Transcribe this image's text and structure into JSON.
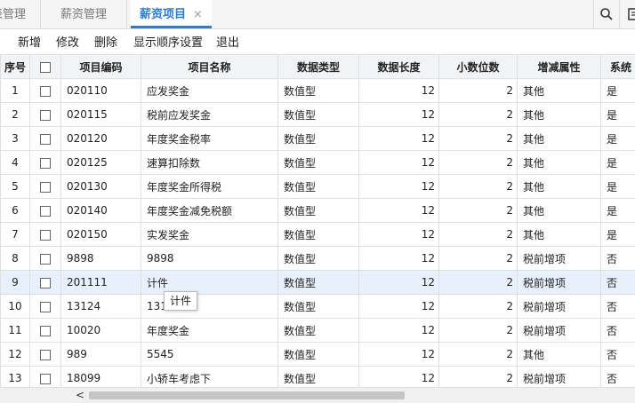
{
  "tabs": [
    {
      "label": "表管理",
      "active": false
    },
    {
      "label": "薪资管理",
      "active": false
    },
    {
      "label": "薪资项目",
      "active": true
    }
  ],
  "tab_close_glyph": "×",
  "icons": {
    "search": "search-icon",
    "more": "more-icon"
  },
  "toolbar": {
    "add_label": "新增",
    "edit_label": "修改",
    "delete_label": "删除",
    "order_label": "显示顺序设置",
    "exit_label": "退出"
  },
  "table": {
    "headers": {
      "seq": "序号",
      "code": "项目编码",
      "name": "项目名称",
      "type": "数据类型",
      "length": "数据长度",
      "decimals": "小数位数",
      "property": "增减属性",
      "system": "系统"
    },
    "rows": [
      {
        "seq": "1",
        "code": "020110",
        "name": "应发奖金",
        "type": "数值型",
        "length": "12",
        "decimals": "2",
        "property": "其他",
        "system": "是"
      },
      {
        "seq": "2",
        "code": "020115",
        "name": "税前应发奖金",
        "type": "数值型",
        "length": "12",
        "decimals": "2",
        "property": "其他",
        "system": "是"
      },
      {
        "seq": "3",
        "code": "020120",
        "name": "年度奖金税率",
        "type": "数值型",
        "length": "12",
        "decimals": "2",
        "property": "其他",
        "system": "是"
      },
      {
        "seq": "4",
        "code": "020125",
        "name": "速算扣除数",
        "type": "数值型",
        "length": "12",
        "decimals": "2",
        "property": "其他",
        "system": "是"
      },
      {
        "seq": "5",
        "code": "020130",
        "name": "年度奖金所得税",
        "type": "数值型",
        "length": "12",
        "decimals": "2",
        "property": "其他",
        "system": "是"
      },
      {
        "seq": "6",
        "code": "020140",
        "name": "年度奖金减免税额",
        "type": "数值型",
        "length": "12",
        "decimals": "2",
        "property": "其他",
        "system": "是"
      },
      {
        "seq": "7",
        "code": "020150",
        "name": "实发奖金",
        "type": "数值型",
        "length": "12",
        "decimals": "2",
        "property": "其他",
        "system": "是"
      },
      {
        "seq": "8",
        "code": "9898",
        "name": "9898",
        "type": "数值型",
        "length": "12",
        "decimals": "2",
        "property": "税前增项",
        "system": "否"
      },
      {
        "seq": "9",
        "code": "201111",
        "name": "计件",
        "type": "数值型",
        "length": "12",
        "decimals": "2",
        "property": "税前增项",
        "system": "否"
      },
      {
        "seq": "10",
        "code": "13124",
        "name": "131",
        "type": "数值型",
        "length": "12",
        "decimals": "2",
        "property": "税前增项",
        "system": "否"
      },
      {
        "seq": "11",
        "code": "10020",
        "name": "年度奖金",
        "type": "数值型",
        "length": "12",
        "decimals": "2",
        "property": "税前增项",
        "system": "否"
      },
      {
        "seq": "12",
        "code": "989",
        "name": "5545",
        "type": "数值型",
        "length": "12",
        "decimals": "2",
        "property": "其他",
        "system": "否"
      },
      {
        "seq": "13",
        "code": "18099",
        "name": "小轿车考虑下",
        "type": "数值型",
        "length": "12",
        "decimals": "2",
        "property": "税前增项",
        "system": "否"
      }
    ]
  },
  "tooltip": {
    "text": "计件"
  },
  "scroll_left_glyph": "<"
}
